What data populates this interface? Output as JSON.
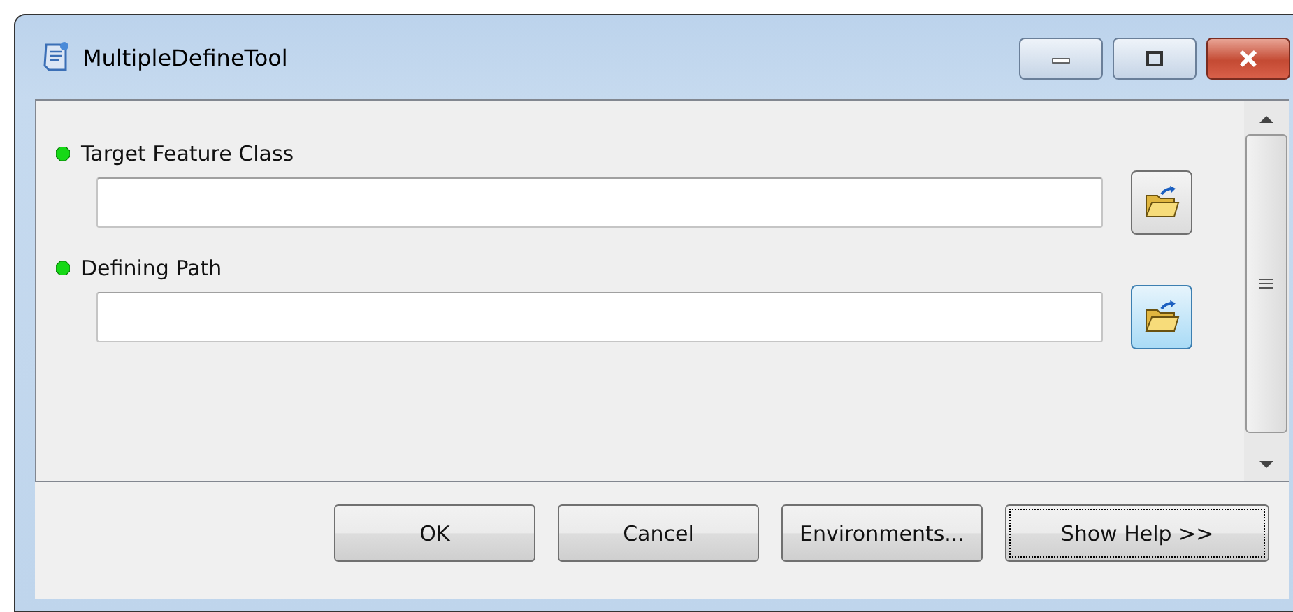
{
  "window": {
    "title": "MultipleDefineTool"
  },
  "parameters": [
    {
      "label": "Target Feature Class",
      "browse_highlighted": false
    },
    {
      "label": "Defining Path",
      "browse_highlighted": true
    }
  ],
  "buttons": [
    {
      "label": "OK",
      "focused": false
    },
    {
      "label": "Cancel",
      "focused": false
    },
    {
      "label": "Environments...",
      "focused": false
    },
    {
      "label": "Show Help >>",
      "focused": true
    }
  ]
}
